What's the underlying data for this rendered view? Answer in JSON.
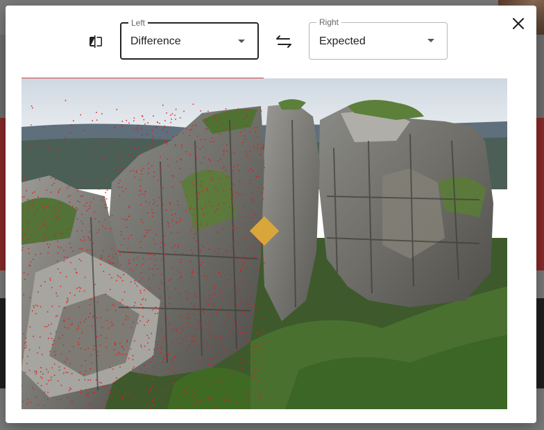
{
  "dialog": {
    "left_select": {
      "legend": "Left",
      "value": "Difference"
    },
    "right_select": {
      "legend": "Right",
      "value": "Expected"
    },
    "icons": {
      "compare": "compare-icon",
      "swap": "swap-horiz-icon",
      "close": "close-icon"
    }
  },
  "colors": {
    "diff_marks": "#e11b1b",
    "handle": "#d9a63b",
    "slider_line": "#d43a3a"
  }
}
